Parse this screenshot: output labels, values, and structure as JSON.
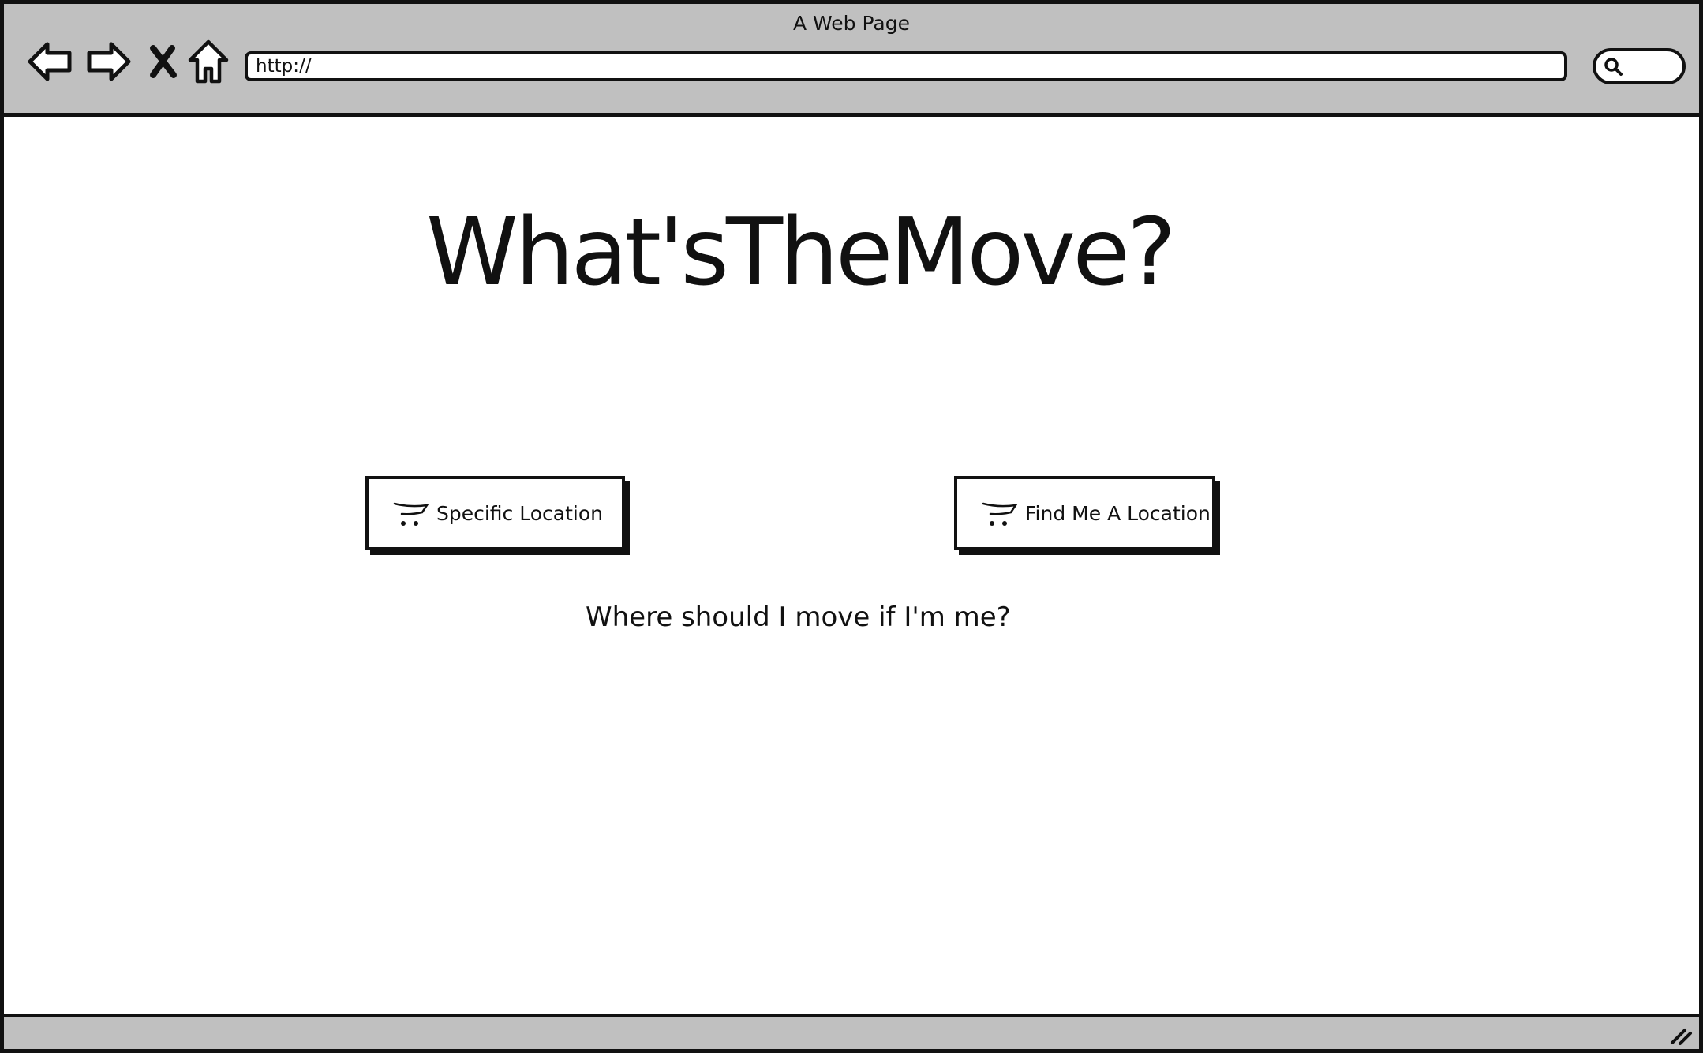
{
  "window": {
    "title": "A Web Page"
  },
  "toolbar": {
    "back_icon": "back-arrow-icon",
    "forward_icon": "forward-arrow-icon",
    "stop_icon": "close-x-icon",
    "home_icon": "home-icon",
    "search_icon": "search-icon"
  },
  "address_bar": {
    "value": "http://"
  },
  "main": {
    "heading": "What'sTheMove?",
    "buttons": [
      {
        "label": "Specific Location",
        "icon": "cart-icon"
      },
      {
        "label": "Find Me A Location",
        "icon": "cart-icon"
      }
    ],
    "tagline": "Where should I move if I'm me?"
  },
  "colors": {
    "chrome": "#c0c0c0",
    "ink": "#111111",
    "page": "#ffffff"
  }
}
